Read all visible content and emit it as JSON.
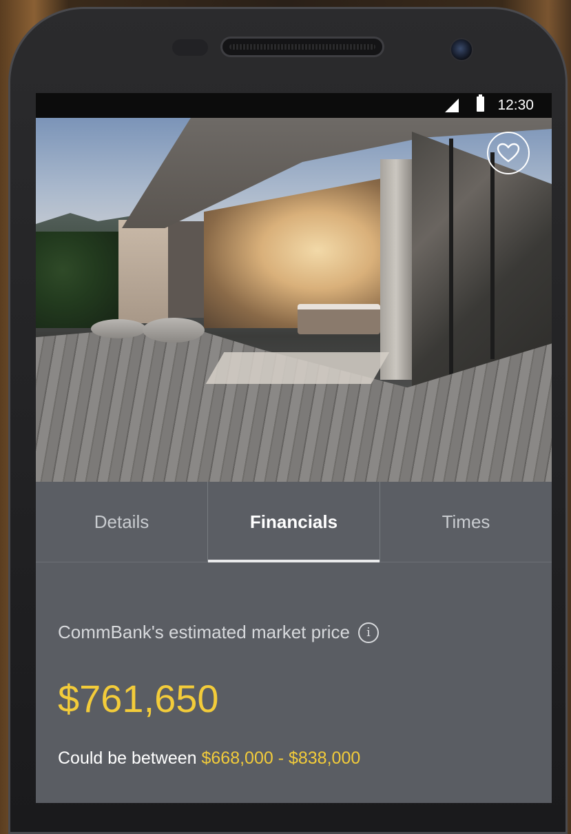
{
  "status_bar": {
    "time": "12:30",
    "icons": [
      "signal-icon",
      "battery-icon"
    ]
  },
  "hero": {
    "favorite_icon": "heart-icon"
  },
  "tabs": [
    {
      "label": "Details",
      "active": false
    },
    {
      "label": "Financials",
      "active": true
    },
    {
      "label": "Times",
      "active": false
    }
  ],
  "financials": {
    "estimate_label": "CommBank's estimated market price",
    "info_icon": "i",
    "price": "$761,650",
    "range_prefix": "Could be between ",
    "range_values": "$668,000 - $838,000"
  },
  "colors": {
    "accent": "#f3cc3a",
    "panel": "#5a5d63",
    "status_bar": "#0c0c0c"
  }
}
